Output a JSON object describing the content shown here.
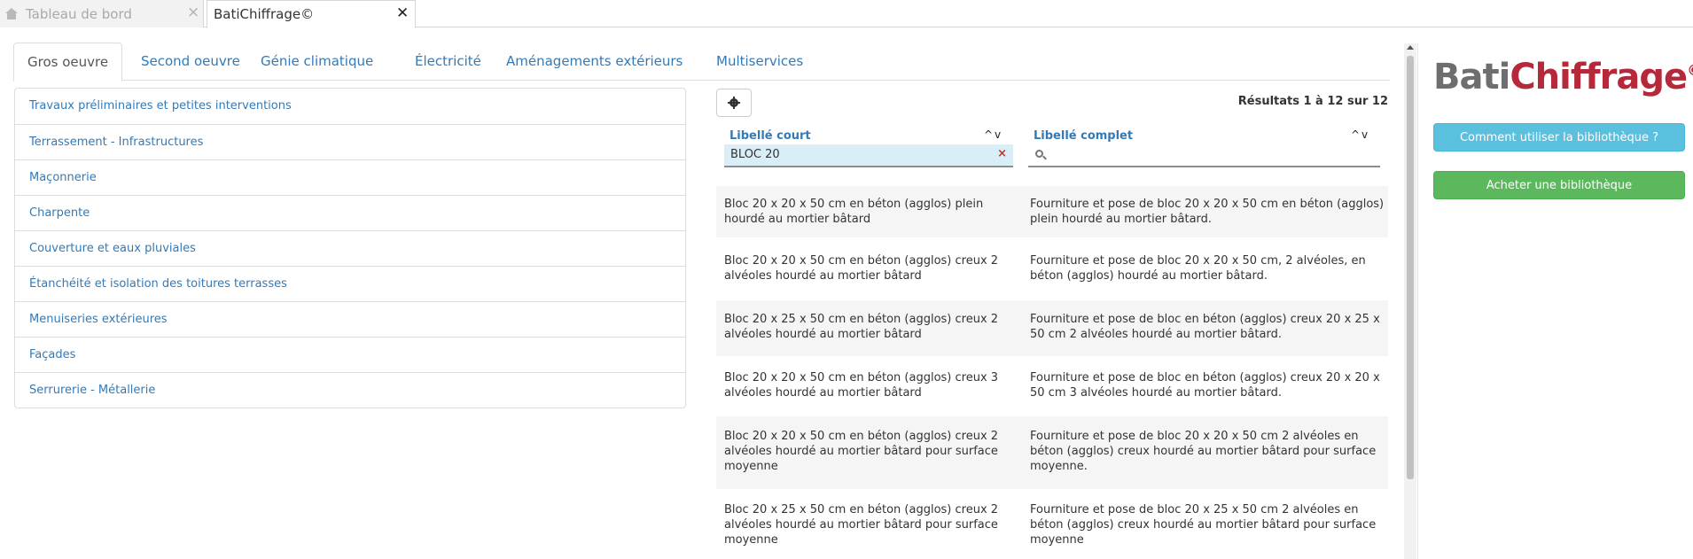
{
  "app_tabs": [
    {
      "label": "Tableau de bord",
      "icon": "home-icon",
      "active": false
    },
    {
      "label": "BatiChiffrage©",
      "active": true
    }
  ],
  "category_tabs": [
    {
      "label": "Gros oeuvre",
      "active": true
    },
    {
      "label": "Second oeuvre"
    },
    {
      "label": "Génie climatique"
    },
    {
      "label": "Électricité"
    },
    {
      "label": "Aménagements extérieurs"
    },
    {
      "label": "Multiservices"
    }
  ],
  "left_list": [
    "Travaux préliminaires et petites interventions",
    "Terrassement - Infrastructures",
    "Maçonnerie",
    "Charpente",
    "Couverture et eaux pluviales",
    "Étanchéité et isolation des toitures terrasses",
    "Menuiseries extérieures",
    "Façades",
    "Serrurerie - Métallerie"
  ],
  "results": {
    "count_text": "Résultats 1 à 12 sur 12",
    "columns": {
      "short_label": "Libellé court",
      "full_label": "Libellé complet",
      "sort_glyph": "^v"
    },
    "filter_short_value": "BLOC 20",
    "filter_clear_glyph": "×",
    "filter_full_value": "",
    "rows": [
      {
        "short": "Bloc 20 x 20 x 50 cm en béton (agglos) plein hourdé au mortier bâtard",
        "full": "Fourniture et pose de bloc 20 x 20 x 50 cm en béton (agglos) plein hourdé au mortier bâtard."
      },
      {
        "short": "Bloc 20 x 20 x 50 cm en béton (agglos) creux 2 alvéoles hourdé au mortier bâtard",
        "full": "Fourniture et pose de bloc 20 x 20 x 50 cm, 2 alvéoles, en béton (agglos) hourdé au mortier bâtard."
      },
      {
        "short": "Bloc 20 x 25 x 50 cm en béton (agglos) creux 2 alvéoles hourdé au mortier bâtard",
        "full": "Fourniture et pose de bloc en béton (agglos) creux 20 x 25 x 50 cm 2 alvéoles hourdé au mortier bâtard."
      },
      {
        "short": "Bloc 20 x 20 x 50 cm en béton (agglos) creux 3 alvéoles hourdé au mortier bâtard",
        "full": "Fourniture et pose de bloc en béton (agglos) creux 20 x 20 x 50 cm 3 alvéoles hourdé au mortier bâtard."
      },
      {
        "short": "Bloc 20 x 20 x 50 cm en béton (agglos) creux 2 alvéoles hourdé au mortier bâtard pour surface moyenne",
        "full": "Fourniture et pose de bloc 20 x 20 x 50 cm 2 alvéoles en béton (agglos) creux hourdé au mortier bâtard pour surface moyenne."
      },
      {
        "short": "Bloc 20 x 25 x 50 cm en béton (agglos) creux 2 alvéoles hourdé au mortier bâtard pour surface moyenne",
        "full": "Fourniture et pose de bloc 20 x 25 x 50 cm 2 alvéoles en béton (agglos) creux hourdé au mortier bâtard pour surface moyenne"
      }
    ]
  },
  "right_panel": {
    "logo": {
      "part1": "Bati",
      "part2": "Chiffrage",
      "mark": "©"
    },
    "help_button": "Comment utiliser la bibliothèque ?",
    "buy_button": "Acheter une bibliothèque"
  },
  "colors": {
    "link": "#337ab7",
    "logo_grey": "#6d6e70",
    "logo_red": "#b5293a",
    "info": "#5bc0de",
    "success": "#5cb85c",
    "filter_bg": "#d9eef7",
    "clear": "#c9302c"
  }
}
